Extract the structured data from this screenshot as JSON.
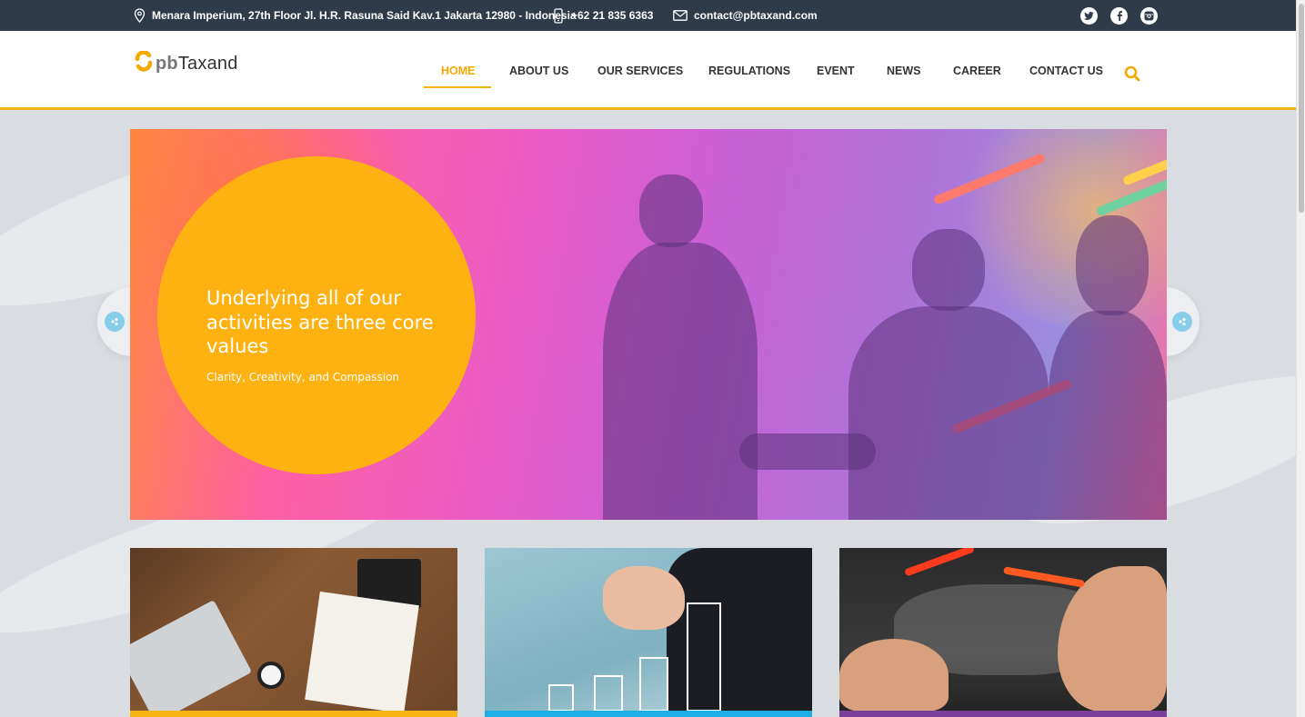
{
  "topbar": {
    "address": "Menara Imperium, 27th Floor Jl. H.R. Rasuna Said Kav.1 Jakarta 12980 - Indonesia",
    "phone": "+62 21 835 6363",
    "email": "contact@pbtaxand.com",
    "social": [
      "twitter-icon",
      "facebook-icon",
      "instagram-icon"
    ]
  },
  "logo": {
    "text": "pbTaxand"
  },
  "nav": {
    "items": [
      "HOME",
      "ABOUT US",
      "OUR SERVICES",
      "REGULATIONS",
      "EVENT",
      "NEWS",
      "CAREER",
      "CONTACT US"
    ],
    "active": "HOME"
  },
  "hero": {
    "title": "Underlying all of our activities are three core values",
    "subtitle": "Clarity, Creativity, and Compassion"
  },
  "cards": [
    {
      "accent": "#f5b415"
    },
    {
      "accent": "#1eaee6"
    },
    {
      "accent": "#7a3f98"
    }
  ],
  "colors": {
    "accent": "#f5b415",
    "topbar": "#2f3b48",
    "circle": "#fdb211"
  }
}
